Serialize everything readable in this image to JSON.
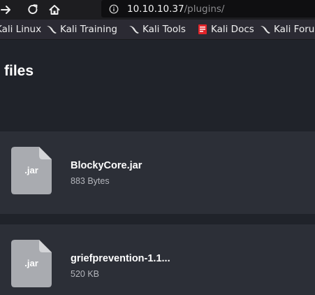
{
  "browser": {
    "url_host": "10.10.10.37",
    "url_path": "/plugins/"
  },
  "bookmarks": [
    {
      "label": "Kali Linux",
      "icon": "kali-dragon-icon"
    },
    {
      "label": "Kali Training",
      "icon": "kali-dragon-icon"
    },
    {
      "label": "Kali Tools",
      "icon": "kali-dragon-icon"
    },
    {
      "label": "Kali Docs",
      "icon": "kali-docs-icon"
    },
    {
      "label": "Kali Forums",
      "icon": "kali-dragon-icon"
    }
  ],
  "page": {
    "title": "files",
    "files": [
      {
        "ext": ".jar",
        "name": "BlockyCore.jar",
        "size": "883 Bytes"
      },
      {
        "ext": ".jar",
        "name": "griefprevention-1.1...",
        "size": "520 KB"
      }
    ]
  },
  "colors": {
    "page_background": "#20232a",
    "card_background": "#2c2f37",
    "file_icon": "#a9abb0",
    "url_path": "#8b8b8e"
  }
}
